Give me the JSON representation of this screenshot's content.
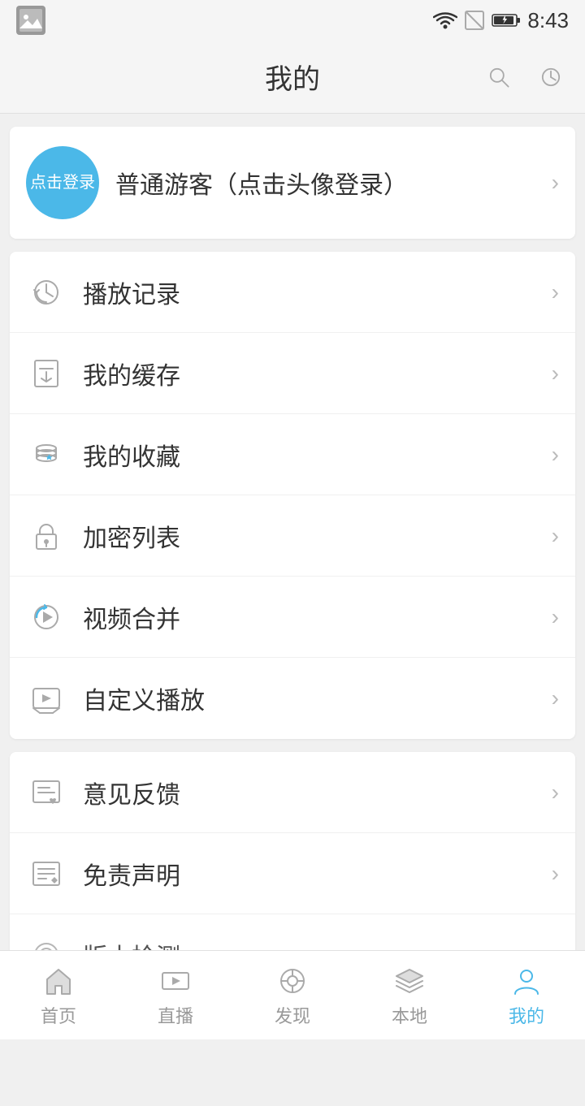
{
  "statusBar": {
    "time": "8:43"
  },
  "header": {
    "title": "我的",
    "searchLabel": "搜索",
    "historyLabel": "历史"
  },
  "profile": {
    "avatarText": "点击登录",
    "name": "普通游客（点击头像登录）"
  },
  "menuSection1": {
    "items": [
      {
        "id": "playback",
        "label": "播放记录"
      },
      {
        "id": "cache",
        "label": "我的缓存"
      },
      {
        "id": "favorites",
        "label": "我的收藏"
      },
      {
        "id": "encrypted",
        "label": "加密列表"
      },
      {
        "id": "merge",
        "label": "视频合并"
      },
      {
        "id": "custom",
        "label": "自定义播放"
      }
    ]
  },
  "menuSection2": {
    "items": [
      {
        "id": "feedback",
        "label": "意见反馈"
      },
      {
        "id": "disclaimer",
        "label": "免责声明"
      },
      {
        "id": "update",
        "label": "版本检测"
      }
    ]
  },
  "bottomNav": {
    "items": [
      {
        "id": "home",
        "label": "首页",
        "active": false
      },
      {
        "id": "live",
        "label": "直播",
        "active": false
      },
      {
        "id": "discover",
        "label": "发现",
        "active": false
      },
      {
        "id": "local",
        "label": "本地",
        "active": false
      },
      {
        "id": "mine",
        "label": "我的",
        "active": true
      }
    ]
  }
}
